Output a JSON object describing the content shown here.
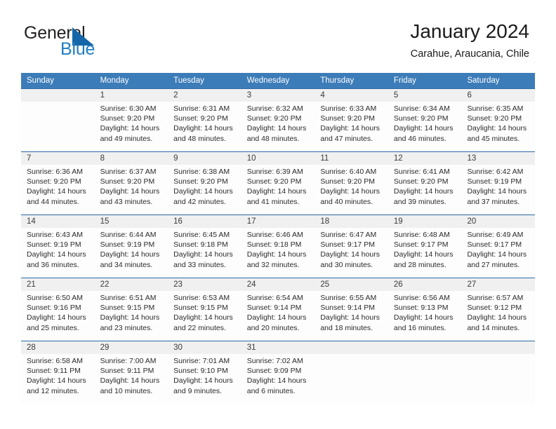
{
  "brand": {
    "name_part1": "General",
    "name_part2": "Blue",
    "accent_color": "#1466a8",
    "blue_text_color": "#1f7ec4"
  },
  "header": {
    "title": "January 2024",
    "subtitle": "Carahue, Araucania, Chile",
    "header_bg_color": "#3c7cb8",
    "week_divider_color": "#2b6ca8",
    "day_number_bg_color": "#f0f0f0"
  },
  "weekdays": [
    "Sunday",
    "Monday",
    "Tuesday",
    "Wednesday",
    "Thursday",
    "Friday",
    "Saturday"
  ],
  "weeks": [
    {
      "days": [
        {
          "num": "",
          "lines": [
            "",
            "",
            "",
            ""
          ]
        },
        {
          "num": "1",
          "lines": [
            "Sunrise: 6:30 AM",
            "Sunset: 9:20 PM",
            "Daylight: 14 hours",
            "and 49 minutes."
          ]
        },
        {
          "num": "2",
          "lines": [
            "Sunrise: 6:31 AM",
            "Sunset: 9:20 PM",
            "Daylight: 14 hours",
            "and 48 minutes."
          ]
        },
        {
          "num": "3",
          "lines": [
            "Sunrise: 6:32 AM",
            "Sunset: 9:20 PM",
            "Daylight: 14 hours",
            "and 48 minutes."
          ]
        },
        {
          "num": "4",
          "lines": [
            "Sunrise: 6:33 AM",
            "Sunset: 9:20 PM",
            "Daylight: 14 hours",
            "and 47 minutes."
          ]
        },
        {
          "num": "5",
          "lines": [
            "Sunrise: 6:34 AM",
            "Sunset: 9:20 PM",
            "Daylight: 14 hours",
            "and 46 minutes."
          ]
        },
        {
          "num": "6",
          "lines": [
            "Sunrise: 6:35 AM",
            "Sunset: 9:20 PM",
            "Daylight: 14 hours",
            "and 45 minutes."
          ]
        }
      ]
    },
    {
      "days": [
        {
          "num": "7",
          "lines": [
            "Sunrise: 6:36 AM",
            "Sunset: 9:20 PM",
            "Daylight: 14 hours",
            "and 44 minutes."
          ]
        },
        {
          "num": "8",
          "lines": [
            "Sunrise: 6:37 AM",
            "Sunset: 9:20 PM",
            "Daylight: 14 hours",
            "and 43 minutes."
          ]
        },
        {
          "num": "9",
          "lines": [
            "Sunrise: 6:38 AM",
            "Sunset: 9:20 PM",
            "Daylight: 14 hours",
            "and 42 minutes."
          ]
        },
        {
          "num": "10",
          "lines": [
            "Sunrise: 6:39 AM",
            "Sunset: 9:20 PM",
            "Daylight: 14 hours",
            "and 41 minutes."
          ]
        },
        {
          "num": "11",
          "lines": [
            "Sunrise: 6:40 AM",
            "Sunset: 9:20 PM",
            "Daylight: 14 hours",
            "and 40 minutes."
          ]
        },
        {
          "num": "12",
          "lines": [
            "Sunrise: 6:41 AM",
            "Sunset: 9:20 PM",
            "Daylight: 14 hours",
            "and 39 minutes."
          ]
        },
        {
          "num": "13",
          "lines": [
            "Sunrise: 6:42 AM",
            "Sunset: 9:19 PM",
            "Daylight: 14 hours",
            "and 37 minutes."
          ]
        }
      ]
    },
    {
      "days": [
        {
          "num": "14",
          "lines": [
            "Sunrise: 6:43 AM",
            "Sunset: 9:19 PM",
            "Daylight: 14 hours",
            "and 36 minutes."
          ]
        },
        {
          "num": "15",
          "lines": [
            "Sunrise: 6:44 AM",
            "Sunset: 9:19 PM",
            "Daylight: 14 hours",
            "and 34 minutes."
          ]
        },
        {
          "num": "16",
          "lines": [
            "Sunrise: 6:45 AM",
            "Sunset: 9:18 PM",
            "Daylight: 14 hours",
            "and 33 minutes."
          ]
        },
        {
          "num": "17",
          "lines": [
            "Sunrise: 6:46 AM",
            "Sunset: 9:18 PM",
            "Daylight: 14 hours",
            "and 32 minutes."
          ]
        },
        {
          "num": "18",
          "lines": [
            "Sunrise: 6:47 AM",
            "Sunset: 9:17 PM",
            "Daylight: 14 hours",
            "and 30 minutes."
          ]
        },
        {
          "num": "19",
          "lines": [
            "Sunrise: 6:48 AM",
            "Sunset: 9:17 PM",
            "Daylight: 14 hours",
            "and 28 minutes."
          ]
        },
        {
          "num": "20",
          "lines": [
            "Sunrise: 6:49 AM",
            "Sunset: 9:17 PM",
            "Daylight: 14 hours",
            "and 27 minutes."
          ]
        }
      ]
    },
    {
      "days": [
        {
          "num": "21",
          "lines": [
            "Sunrise: 6:50 AM",
            "Sunset: 9:16 PM",
            "Daylight: 14 hours",
            "and 25 minutes."
          ]
        },
        {
          "num": "22",
          "lines": [
            "Sunrise: 6:51 AM",
            "Sunset: 9:15 PM",
            "Daylight: 14 hours",
            "and 23 minutes."
          ]
        },
        {
          "num": "23",
          "lines": [
            "Sunrise: 6:53 AM",
            "Sunset: 9:15 PM",
            "Daylight: 14 hours",
            "and 22 minutes."
          ]
        },
        {
          "num": "24",
          "lines": [
            "Sunrise: 6:54 AM",
            "Sunset: 9:14 PM",
            "Daylight: 14 hours",
            "and 20 minutes."
          ]
        },
        {
          "num": "25",
          "lines": [
            "Sunrise: 6:55 AM",
            "Sunset: 9:14 PM",
            "Daylight: 14 hours",
            "and 18 minutes."
          ]
        },
        {
          "num": "26",
          "lines": [
            "Sunrise: 6:56 AM",
            "Sunset: 9:13 PM",
            "Daylight: 14 hours",
            "and 16 minutes."
          ]
        },
        {
          "num": "27",
          "lines": [
            "Sunrise: 6:57 AM",
            "Sunset: 9:12 PM",
            "Daylight: 14 hours",
            "and 14 minutes."
          ]
        }
      ]
    },
    {
      "days": [
        {
          "num": "28",
          "lines": [
            "Sunrise: 6:58 AM",
            "Sunset: 9:11 PM",
            "Daylight: 14 hours",
            "and 12 minutes."
          ]
        },
        {
          "num": "29",
          "lines": [
            "Sunrise: 7:00 AM",
            "Sunset: 9:11 PM",
            "Daylight: 14 hours",
            "and 10 minutes."
          ]
        },
        {
          "num": "30",
          "lines": [
            "Sunrise: 7:01 AM",
            "Sunset: 9:10 PM",
            "Daylight: 14 hours",
            "and 9 minutes."
          ]
        },
        {
          "num": "31",
          "lines": [
            "Sunrise: 7:02 AM",
            "Sunset: 9:09 PM",
            "Daylight: 14 hours",
            "and 6 minutes."
          ]
        },
        {
          "num": "",
          "lines": [
            "",
            "",
            "",
            ""
          ]
        },
        {
          "num": "",
          "lines": [
            "",
            "",
            "",
            ""
          ]
        },
        {
          "num": "",
          "lines": [
            "",
            "",
            "",
            ""
          ]
        }
      ]
    }
  ]
}
